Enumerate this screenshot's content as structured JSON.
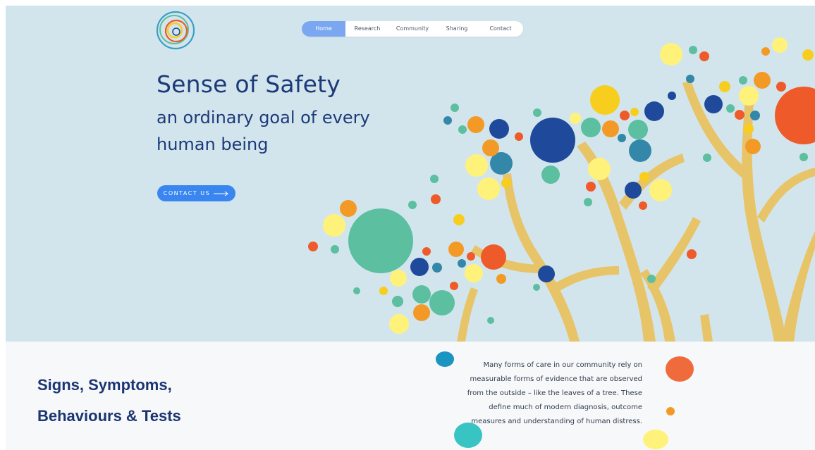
{
  "nav": {
    "tabs": [
      {
        "label": "Home",
        "active": true
      },
      {
        "label": "Research",
        "active": false
      },
      {
        "label": "Community",
        "active": false
      },
      {
        "label": "Sharing",
        "active": false
      },
      {
        "label": "Contact",
        "active": false
      }
    ]
  },
  "hero": {
    "title": "Sense of Safety",
    "subtitle": "an ordinary goal of every human being",
    "cta_label": "CONTACT US"
  },
  "section": {
    "title_line1": "Signs, Symptoms,",
    "title_line2": "Behaviours & Tests",
    "body": "Many forms of care in our community rely on measurable forms of evidence that are observed from the outside – like the leaves of a tree. These define much of modern diagnosis, outcome measures and understanding of human distress."
  },
  "colors": {
    "hero_bg": "#d3e5ec",
    "navy_text": "#1c3a7a",
    "cta_blue": "#3a86f0",
    "nav_active": "#7aa7f0",
    "branch": "#e8c468",
    "leaf_teal": "#5bbfa0",
    "leaf_navy": "#1f4a9c",
    "leaf_orange": "#f39a26",
    "leaf_red": "#ef5a2a",
    "leaf_yellow": "#fff27a",
    "leaf_gold": "#f7cd1e",
    "leaf_blue": "#3387a8"
  },
  "icons": {
    "logo": "concentric-spiral-logo",
    "cta": "arrow-right-icon"
  }
}
